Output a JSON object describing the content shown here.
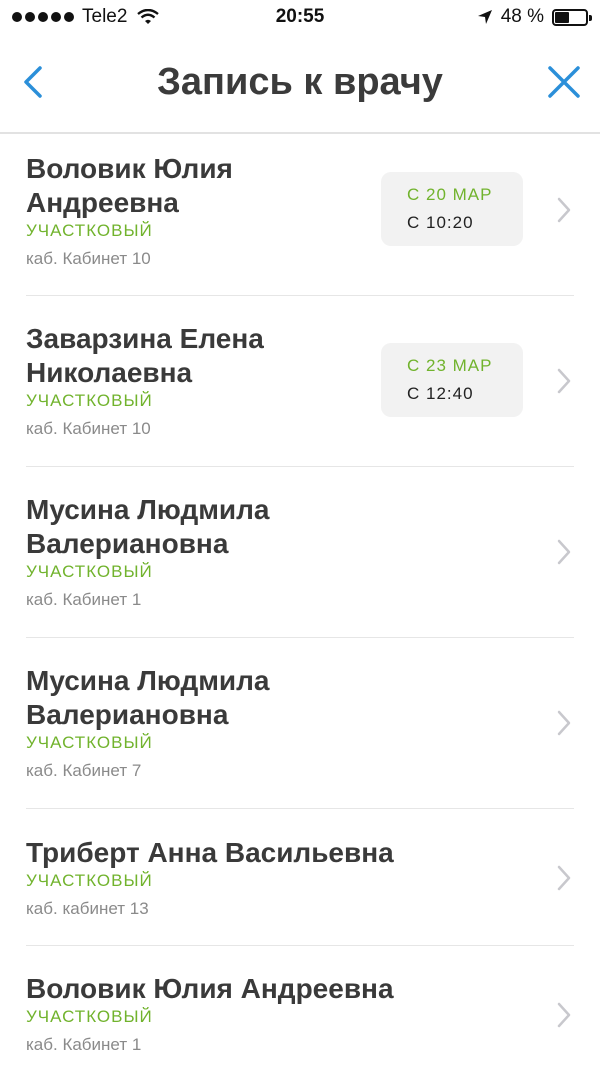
{
  "status_bar": {
    "carrier": "Tele2",
    "time": "20:55",
    "battery_percent": "48 %",
    "battery_level": 0.48
  },
  "nav": {
    "title": "Запись к врачу",
    "back_icon": "chevron-left-icon",
    "close_icon": "close-icon"
  },
  "colors": {
    "accent_blue": "#2b8fd9",
    "role_green": "#71b32d",
    "text_dark": "#3a3a3a",
    "text_muted": "#8a8a8a"
  },
  "doctors": [
    {
      "name": "Воловик Юлия Андреевна",
      "role": "УЧАСТКОВЫЙ",
      "cabinet": "каб. Кабинет 10",
      "slot_date": "С 20 МАР",
      "slot_time": "С 10:20"
    },
    {
      "name": "Заварзина Елена Николаевна",
      "role": "УЧАСТКОВЫЙ",
      "cabinet": "каб. Кабинет 10",
      "slot_date": "С 23 МАР",
      "slot_time": "С 12:40"
    },
    {
      "name": "Мусина Людмила Валериановна",
      "role": "УЧАСТКОВЫЙ",
      "cabinet": "каб. Кабинет 1"
    },
    {
      "name": "Мусина Людмила Валериановна",
      "role": "УЧАСТКОВЫЙ",
      "cabinet": "каб. Кабинет 7"
    },
    {
      "name": "Триберт Анна Васильевна",
      "role": "УЧАСТКОВЫЙ",
      "cabinet": "каб. кабинет 13"
    },
    {
      "name": "Воловик Юлия Андреевна",
      "role": "УЧАСТКОВЫЙ",
      "cabinet": "каб. Кабинет 1"
    }
  ]
}
